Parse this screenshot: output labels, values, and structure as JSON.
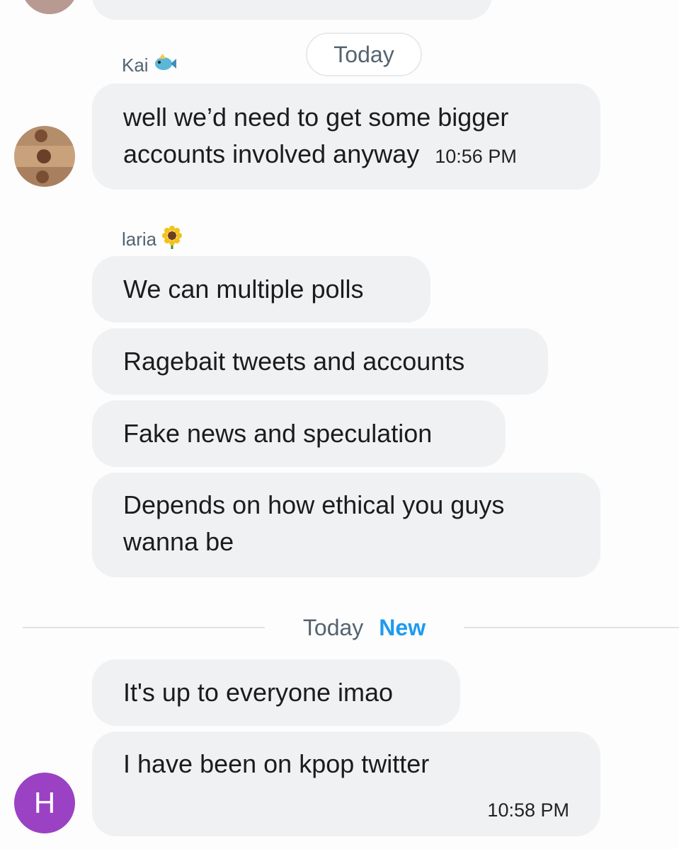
{
  "colors": {
    "bubble": "#eff1f3",
    "accent": "#1d9bf0",
    "muted": "#536471",
    "avatar_h": "#9b42c4"
  },
  "date_pill": "Today",
  "messages_kai": {
    "sender": "Kai",
    "sender_emoji": "fish",
    "text_line1": "well we’d need to get some bigger",
    "text_line2": "accounts involved anyway",
    "time": "10:56 PM"
  },
  "messages_laria": {
    "sender": "laria",
    "sender_emoji": "sunflower",
    "msg1": "We can multiple polls",
    "msg2": "Ragebait tweets and accounts",
    "msg3": "Fake news and speculation",
    "msg4_line1": "Depends on how ethical you guys",
    "msg4_line2": "wanna be"
  },
  "new_divider": {
    "label": "Today",
    "badge": "New"
  },
  "messages_h": {
    "avatar_letter": "H",
    "msg1": "It's up to everyone imao",
    "msg2": "I have been on kpop twitter",
    "time": "10:58 PM"
  }
}
